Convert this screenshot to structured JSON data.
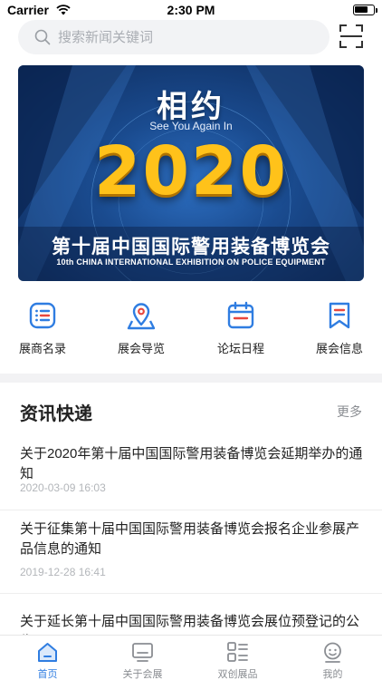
{
  "status_bar": {
    "carrier": "Carrier",
    "time": "2:30 PM"
  },
  "search": {
    "placeholder": "搜索新闻关键词"
  },
  "banner": {
    "headline": "相约",
    "subline": "See You Again In",
    "year": "2020",
    "event_cn": "第十届中国国际警用装备博览会",
    "event_en": "10th CHINA INTERNATIONAL EXHIBITION ON POLICE EQUIPMENT"
  },
  "quick_menu": [
    {
      "label": "展商名录",
      "icon": "list-icon"
    },
    {
      "label": "展会导览",
      "icon": "map-pin-icon"
    },
    {
      "label": "论坛日程",
      "icon": "calendar-icon"
    },
    {
      "label": "展会信息",
      "icon": "bookmark-icon"
    }
  ],
  "news": {
    "title": "资讯快递",
    "more_label": "更多",
    "items": [
      {
        "title": "关于2020年第十届中国国际警用装备博览会延期举办的通知",
        "date": "2020-03-09 16:03"
      },
      {
        "title": "关于征集第十届中国国际警用装备博览会报名企业参展产品信息的通知",
        "date": "2019-12-28 16:41"
      },
      {
        "title": "关于延长第十届中国国际警用装备博览会展位预登记的公告",
        "date": ""
      }
    ]
  },
  "tab_bar": [
    {
      "label": "首页",
      "icon": "home-icon",
      "active": true
    },
    {
      "label": "关于会展",
      "icon": "monitor-icon",
      "active": false
    },
    {
      "label": "双创展品",
      "icon": "grid-icon",
      "active": false
    },
    {
      "label": "我的",
      "icon": "user-icon",
      "active": false
    }
  ],
  "colors": {
    "accent": "#2f7de1",
    "banner_gold": "#ffc21a",
    "banner_blue": "#1a4b8f"
  }
}
